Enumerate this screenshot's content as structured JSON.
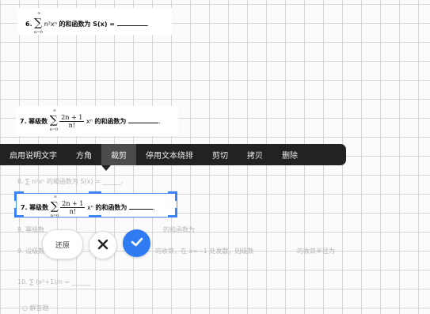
{
  "q6": {
    "num": "6.",
    "sum_top": "∞",
    "sum_bot": "n=0",
    "term": "n²xⁿ",
    "text": "的和函数为 S(x) =",
    "end": "."
  },
  "q7": {
    "num": "7.",
    "prefix": "幂级数",
    "sum_top": "∞",
    "sum_bot": "n=0",
    "numerator": "2n + 1",
    "denominator": "n!",
    "term": "xⁿ",
    "text": "的和函数为",
    "end": "."
  },
  "toolbar": {
    "items": [
      "启用说明文字",
      "方角",
      "裁剪",
      "停用文本绕排",
      "剪切",
      "拷贝",
      "删除"
    ],
    "active_index": 2
  },
  "faded": {
    "l1": "8. ∑ n²xⁿ 的和函数为 S(x) = ______.",
    "l2": "8. 幂级数",
    "l3": "的和函数为",
    "l4": "9. 设级数",
    "l5": "的收敛，在 x=−1 处发散，则级数",
    "l6": "的收敛半径为",
    "l7": "10. ∑ (x²+1)/n = ______",
    "l8": "○ 解答题"
  },
  "actions": {
    "restore": "还原"
  },
  "colors": {
    "toolbar_bg": "#222222",
    "active_item": "#4b4b4b",
    "accent": "#2f7cf2",
    "selection": "#4a8fe8"
  },
  "icons": {
    "cancel": "close-icon",
    "confirm": "check-icon"
  }
}
